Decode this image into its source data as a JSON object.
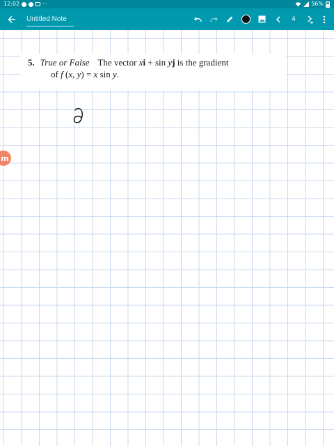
{
  "status": {
    "time": "12:02",
    "more": "···",
    "battery": "56%"
  },
  "toolbar": {
    "title": "Untitled Note",
    "page_number": "4",
    "icons": [
      "back-arrow-icon",
      "undo-icon",
      "redo-icon",
      "pen-icon",
      "color-swatch-icon",
      "image-icon",
      "prev-page-icon",
      "next-page-icon",
      "more-icon"
    ],
    "pen_color": "#111111",
    "accent": "#0099ae"
  },
  "problem": {
    "number": "5.",
    "label": "True or False",
    "line1_text": "The vector ",
    "x": "x",
    "i": "i",
    "plus_sin": " + sin ",
    "y": "y",
    "j": "j",
    "line1_end": " is the gradient",
    "line2_of": "of ",
    "f": "f",
    "args_open": " (",
    "args_x": "x",
    "args_comma": ", ",
    "args_y": "y",
    "args_close": ") = ",
    "rhs_x": "x",
    "rhs_sin": " sin ",
    "rhs_y": "y",
    "rhs_end": "."
  },
  "badge": {
    "letter": "m"
  }
}
